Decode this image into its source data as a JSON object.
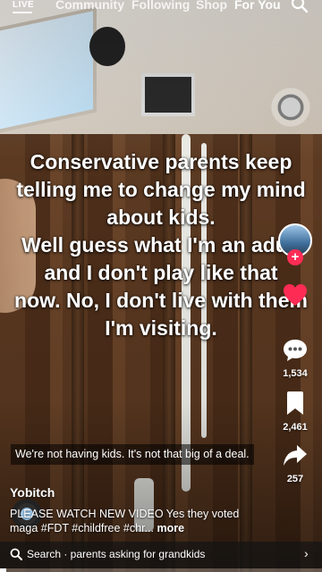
{
  "top_nav": {
    "live_label": "LIVE",
    "tabs": [
      {
        "label": "Community"
      },
      {
        "label": "Following"
      },
      {
        "label": "Shop"
      },
      {
        "label": "For You"
      }
    ],
    "active_tab": "For You"
  },
  "video": {
    "caption_lines": [
      "Conservative parents keep",
      "telling me to change my mind",
      "about kids.",
      "Well guess what I'm an adult",
      "and I don't play like that",
      "now. No, I don't live with them",
      "I'm visiting."
    ],
    "subtitle": "We're not having kids. It's not that big of a deal.",
    "progress_fraction": 0.02
  },
  "actions": {
    "likes": "",
    "comments": "1,534",
    "saves": "2,461",
    "shares": "257",
    "follow_glyph": "+"
  },
  "post": {
    "username": "Yobitch",
    "description": "PLEASE WATCH NEW VIDEO Yes they voted maga #FDT #childfree #chr...",
    "more_label": "more"
  },
  "search_bar": {
    "text": "Search · parents asking for grandkids"
  },
  "colors": {
    "accent_red": "#fe2c55",
    "text": "#ffffff"
  },
  "icons": [
    "search-icon",
    "heart-icon",
    "comment-icon",
    "bookmark-icon",
    "share-icon",
    "music-disc-icon",
    "chevron-right-icon"
  ]
}
